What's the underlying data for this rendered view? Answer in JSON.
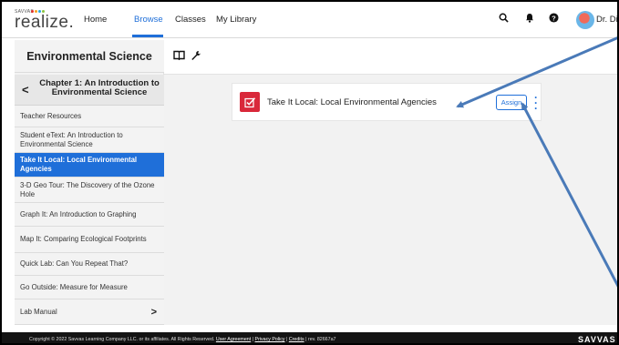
{
  "brand": {
    "small": "SAVVAS",
    "main": "realize.",
    "dot_colors": [
      "#e4322b",
      "#f6a21e",
      "#26a7df",
      "#8bc53f"
    ]
  },
  "nav": {
    "items": [
      {
        "label": "Home"
      },
      {
        "label": "Browse"
      },
      {
        "label": "Classes"
      },
      {
        "label": "My Library"
      }
    ],
    "active": "Browse",
    "icons": [
      "search-icon",
      "bell-icon",
      "help-icon"
    ],
    "user_name": "Dr. Dish"
  },
  "sidebar": {
    "title": "Environmental Science",
    "chapter": "Chapter 1: An Introduction to Environmental Science",
    "items": [
      {
        "label": "Teacher Resources"
      },
      {
        "label": "Student eText: An Introduction to Environmental Science"
      },
      {
        "label": "Take It Local: Local Environmental Agencies"
      },
      {
        "label": "3-D Geo Tour: The Discovery of the Ozone Hole"
      },
      {
        "label": "Graph It: An Introduction to Graphing"
      },
      {
        "label": "Map It: Comparing Ecological Footprints"
      },
      {
        "label": "Quick Lab: Can You Repeat That?"
      },
      {
        "label": "Go Outside: Measure for Measure"
      },
      {
        "label": "Lab Manual"
      }
    ],
    "active_index": 2
  },
  "toolbar": {
    "icons": [
      "book-icon",
      "wrench-icon"
    ]
  },
  "content": {
    "card_title": "Take It Local: Local Environmental Agencies",
    "assign_label": "Assign"
  },
  "footer": {
    "copyright": "Copyright © 2022 Savvas Learning Company LLC. or its affiliates. All Rights Reserved.",
    "links": [
      "User Agreement",
      "Privacy Policy",
      "Credits"
    ],
    "rev": "rev. 82667a7",
    "brand": "SAVVAS"
  },
  "colors": {
    "accent": "#1f6fd9",
    "card_icon": "#d9283a",
    "annotation_arrow": "#4a7ab8"
  }
}
